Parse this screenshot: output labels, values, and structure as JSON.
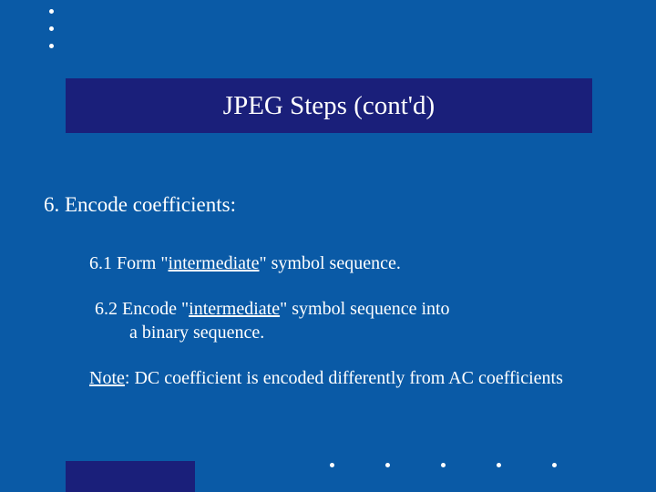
{
  "title": "JPEG Steps (cont'd)",
  "step": {
    "number": "6.",
    "label": "Encode coefficients:"
  },
  "substeps": [
    {
      "number": "6.1",
      "prefix": "Form \"",
      "key": "intermediate",
      "suffix": "\" symbol sequence."
    },
    {
      "number": "6.2",
      "prefix": "Encode \"",
      "key": "intermediate",
      "suffix": "\" symbol sequence into",
      "cont": "a binary sequence."
    }
  ],
  "note": {
    "label": "Note",
    "text": ": DC coefficient is encoded differently from AC coefficients"
  }
}
